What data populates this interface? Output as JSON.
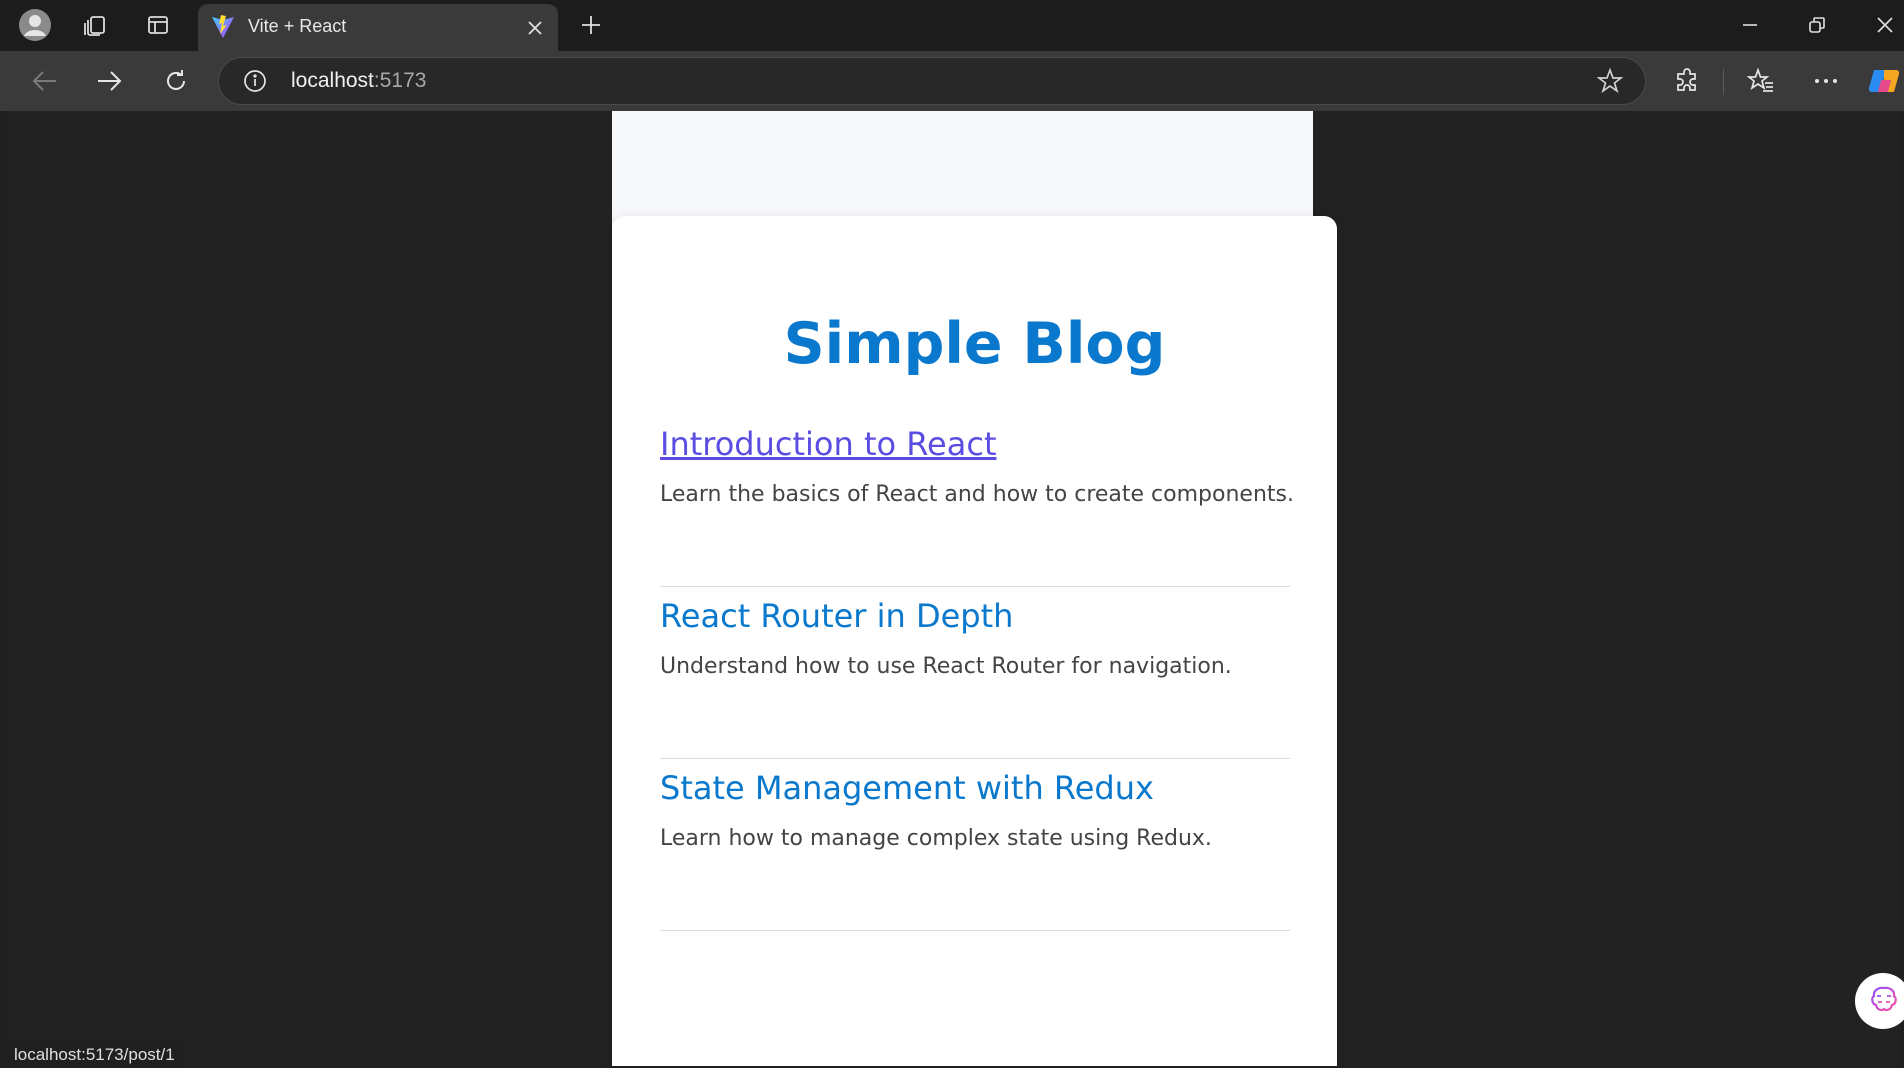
{
  "browser": {
    "tab": {
      "title": "Vite + React"
    },
    "address": {
      "host": "localhost",
      "port": ":5173"
    }
  },
  "page": {
    "title": "Simple Blog",
    "posts": [
      {
        "title": "Introduction to React",
        "excerpt": "Learn the basics of React and how to create components.",
        "visited": true
      },
      {
        "title": "React Router in Depth",
        "excerpt": "Understand how to use React Router for navigation.",
        "visited": false
      },
      {
        "title": "State Management with Redux",
        "excerpt": "Learn how to manage complex state using Redux.",
        "visited": false
      }
    ]
  },
  "status_bar": {
    "url": "localhost:5173/post/1"
  },
  "colors": {
    "accent": "#0a78cc",
    "visited_link": "#5b4de2",
    "excerpt_text": "#444444",
    "page_bg": "#f7f8fa",
    "card_bg": "#ffffff"
  },
  "icons": {
    "tabbar": [
      "profile-avatar-icon",
      "collections-icon",
      "tab-actions-icon",
      "vite-favicon-icon",
      "close-icon",
      "new-tab-icon",
      "minimize-icon",
      "restore-icon",
      "window-close-icon"
    ],
    "toolbar": [
      "back-icon",
      "forward-icon",
      "refresh-icon",
      "info-icon",
      "favorite-star-icon",
      "extensions-icon",
      "favorites-icon",
      "more-icon",
      "copilot-icon"
    ]
  }
}
